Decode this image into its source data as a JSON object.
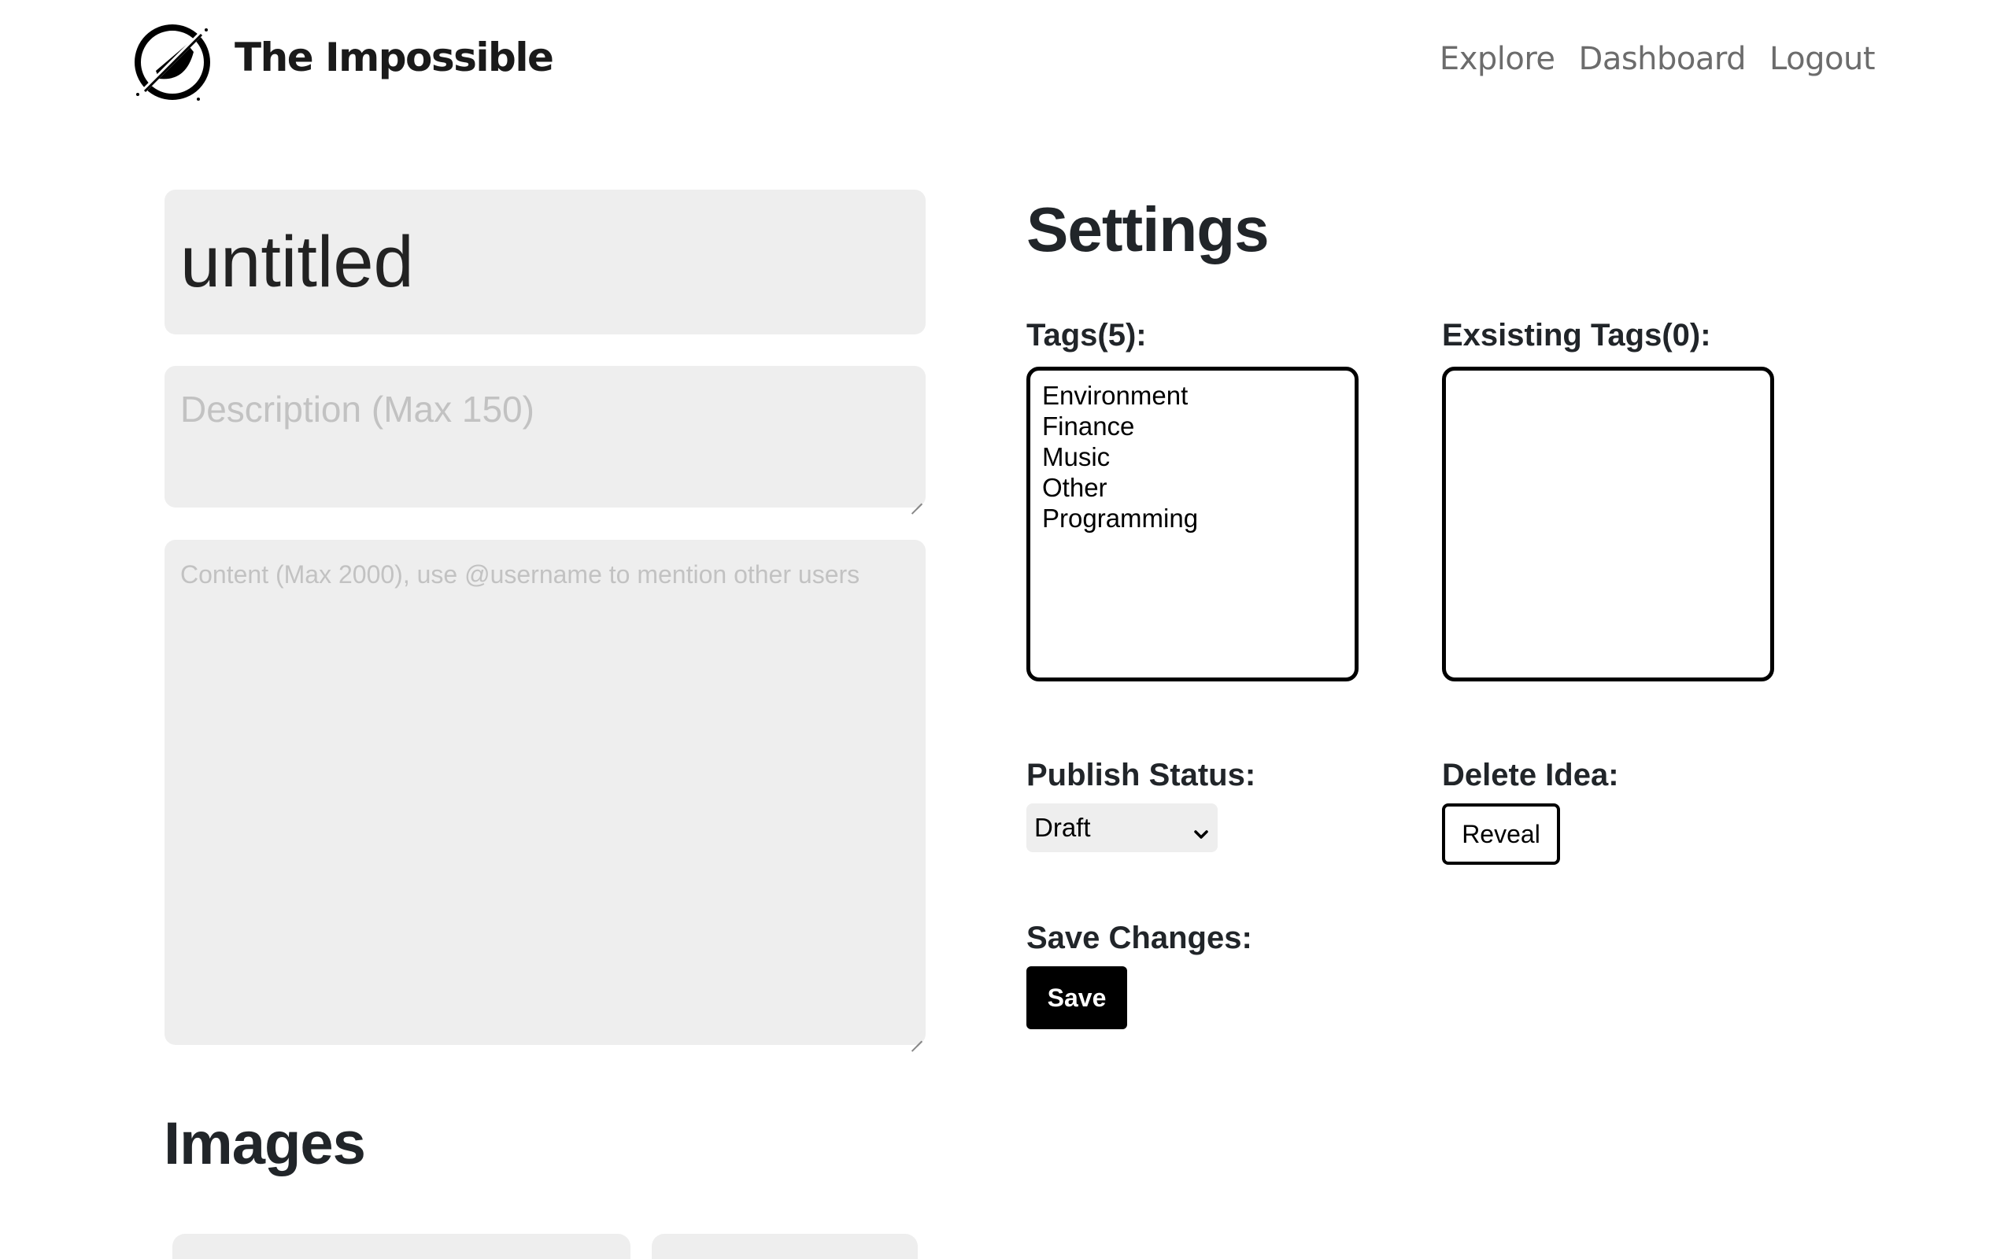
{
  "header": {
    "brand": "The Impossible",
    "nav": [
      {
        "label": "Explore"
      },
      {
        "label": "Dashboard"
      },
      {
        "label": "Logout"
      }
    ]
  },
  "editor": {
    "title_value": "untitled",
    "description_placeholder": "Description (Max 150)",
    "content_placeholder": "Content (Max 2000), use @username to mention other users"
  },
  "images": {
    "heading": "Images"
  },
  "settings": {
    "heading": "Settings",
    "tags_label": "Tags(5):",
    "tags": [
      "Environment",
      "Finance",
      "Music",
      "Other",
      "Programming"
    ],
    "existing_tags_label": "Exsisting Tags(0):",
    "existing_tags": [],
    "publish_label": "Publish Status:",
    "publish_value": "Draft",
    "delete_label": "Delete Idea:",
    "reveal_label": "Reveal",
    "save_label": "Save Changes:",
    "save_button": "Save"
  },
  "icons": {
    "logo": "impossible-logo-icon",
    "select_arrow": "chevron-down-icon"
  }
}
